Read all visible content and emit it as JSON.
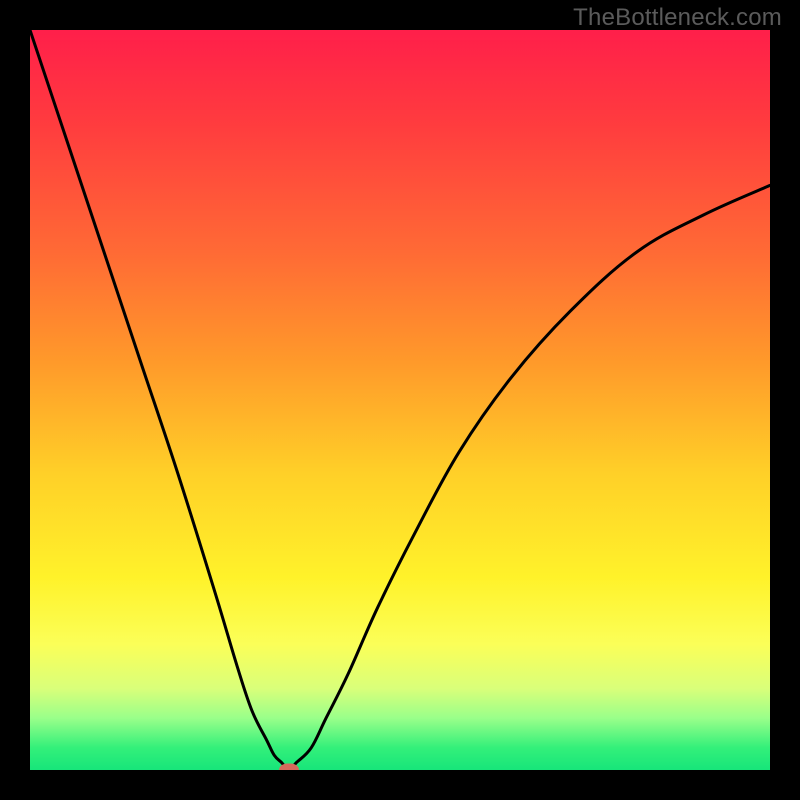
{
  "watermark": "TheBottleneck.com",
  "colors": {
    "frame": "#000000",
    "curve": "#000000",
    "dot": "#d66a5c",
    "gradient_stops": [
      "#ff1f4a",
      "#ff3a3f",
      "#ff6a35",
      "#ff9a2a",
      "#ffd028",
      "#fff22a",
      "#fbff58",
      "#d9ff7a",
      "#99ff8a",
      "#33f07a",
      "#17e57a"
    ]
  },
  "chart_data": {
    "type": "line",
    "title": "",
    "xlabel": "",
    "ylabel": "",
    "xlim": [
      0,
      100
    ],
    "ylim": [
      0,
      100
    ],
    "grid": false,
    "legend": false,
    "series": [
      {
        "name": "bottleneck-curve",
        "x": [
          0,
          5,
          10,
          15,
          20,
          25,
          28,
          30,
          32,
          33,
          34,
          35,
          36,
          38,
          40,
          43,
          47,
          52,
          58,
          65,
          73,
          82,
          91,
          100
        ],
        "values": [
          100,
          85,
          70,
          55,
          40,
          24,
          14,
          8,
          4,
          2,
          1,
          0,
          1,
          3,
          7,
          13,
          22,
          32,
          43,
          53,
          62,
          70,
          75,
          79
        ]
      }
    ],
    "marker": {
      "x": 35,
      "y": 0,
      "name": "optimal-point"
    }
  }
}
